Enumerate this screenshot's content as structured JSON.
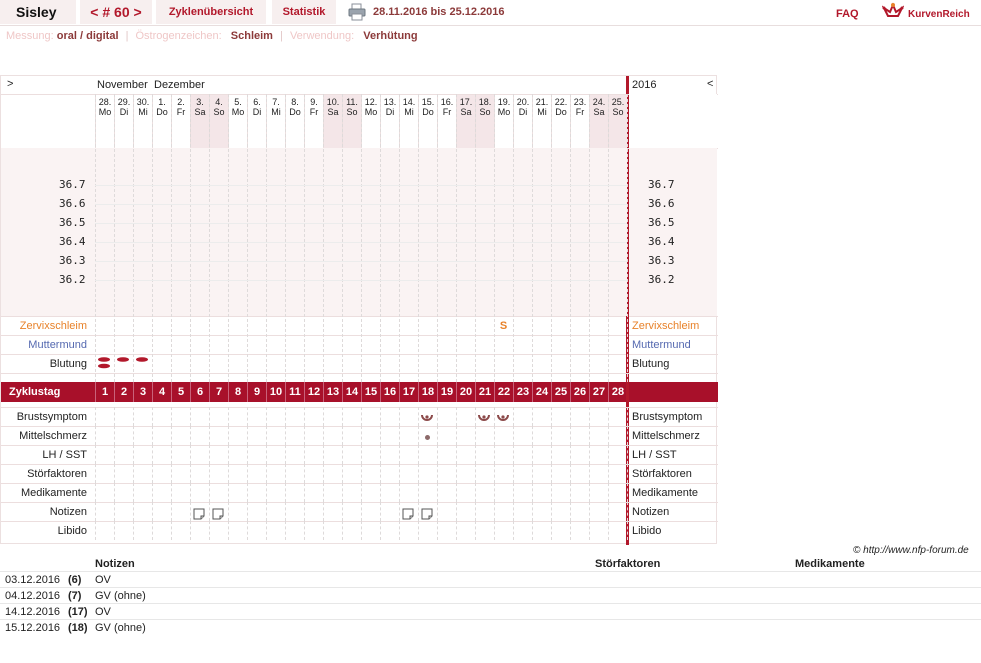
{
  "header": {
    "title": "Sisley",
    "cycle_nav": "< # 60 >",
    "tab_overview": "Zyklenübersicht",
    "tab_stats": "Statistik",
    "date_range": "28.11.2016 bis 25.12.2016",
    "faq": "FAQ",
    "brand": "KurvenReich",
    "print_icon": "printer-icon"
  },
  "subheader": {
    "measure_label": "Messung:",
    "measure_value": "oral / digital",
    "estrogen_label": "Östrogenzeichen:",
    "estrogen_value": "Schleim",
    "use_label": "Verwendung:",
    "use_value": "Verhütung"
  },
  "chart": {
    "nav_left": ">",
    "nav_right": "<",
    "month1": "November",
    "month2": "Dezember",
    "year": "2016",
    "days": [
      {
        "d": "28.",
        "w": "Mo",
        "we": false
      },
      {
        "d": "29.",
        "w": "Di",
        "we": false
      },
      {
        "d": "30.",
        "w": "Mi",
        "we": false
      },
      {
        "d": "1.",
        "w": "Do",
        "we": false
      },
      {
        "d": "2.",
        "w": "Fr",
        "we": false
      },
      {
        "d": "3.",
        "w": "Sa",
        "we": true
      },
      {
        "d": "4.",
        "w": "So",
        "we": true
      },
      {
        "d": "5.",
        "w": "Mo",
        "we": false
      },
      {
        "d": "6.",
        "w": "Di",
        "we": false
      },
      {
        "d": "7.",
        "w": "Mi",
        "we": false
      },
      {
        "d": "8.",
        "w": "Do",
        "we": false
      },
      {
        "d": "9.",
        "w": "Fr",
        "we": false
      },
      {
        "d": "10.",
        "w": "Sa",
        "we": true
      },
      {
        "d": "11.",
        "w": "So",
        "we": true
      },
      {
        "d": "12.",
        "w": "Mo",
        "we": false
      },
      {
        "d": "13.",
        "w": "Di",
        "we": false
      },
      {
        "d": "14.",
        "w": "Mi",
        "we": false
      },
      {
        "d": "15.",
        "w": "Do",
        "we": false
      },
      {
        "d": "16.",
        "w": "Fr",
        "we": false
      },
      {
        "d": "17.",
        "w": "Sa",
        "we": true
      },
      {
        "d": "18.",
        "w": "So",
        "we": true
      },
      {
        "d": "19.",
        "w": "Mo",
        "we": false
      },
      {
        "d": "20.",
        "w": "Di",
        "we": false
      },
      {
        "d": "21.",
        "w": "Mi",
        "we": false
      },
      {
        "d": "22.",
        "w": "Do",
        "we": false
      },
      {
        "d": "23.",
        "w": "Fr",
        "we": false
      },
      {
        "d": "24.",
        "w": "Sa",
        "we": true
      },
      {
        "d": "25.",
        "w": "So",
        "we": true
      }
    ],
    "temps": [
      "36.7",
      "36.6",
      "36.5",
      "36.4",
      "36.3",
      "36.2"
    ],
    "rows": {
      "cervix": "Zervixschleim",
      "cervix_color": "#e8822a",
      "cervix_value": "S",
      "cervix_day": 22,
      "mutter": "Muttermund",
      "mutter_color": "#5569b0",
      "blutung": "Blutung",
      "blutung_days": [
        1,
        2,
        3
      ],
      "zyklustag": "Zyklustag",
      "brust": "Brustsymptom",
      "brust_days": [
        18,
        21,
        22
      ],
      "mittel": "Mittelschmerz",
      "mittel_days": [
        18
      ],
      "lh": "LH / SST",
      "stoer": "Störfaktoren",
      "medi": "Medikamente",
      "notizen": "Notizen",
      "notiz_days": [
        6,
        7,
        17,
        18
      ],
      "libido": "Libido"
    },
    "accent": "#a8102a"
  },
  "copyright": "© http://www.nfp-forum.de",
  "notes": {
    "headers": [
      "Notizen",
      "Störfaktoren",
      "Medikamente"
    ],
    "entries": [
      {
        "date": "03.12.2016",
        "day": "(6)",
        "text": "OV"
      },
      {
        "date": "04.12.2016",
        "day": "(7)",
        "text": "GV (ohne)"
      },
      {
        "date": "14.12.2016",
        "day": "(17)",
        "text": "OV"
      },
      {
        "date": "15.12.2016",
        "day": "(18)",
        "text": "GV (ohne)"
      }
    ]
  }
}
